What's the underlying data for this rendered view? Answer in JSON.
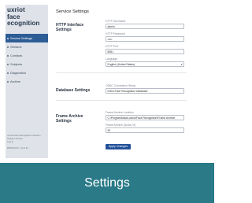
{
  "sidebar": {
    "brand": [
      "uxriot",
      "face",
      "ecognition"
    ],
    "items": [
      {
        "label": "Service Settings",
        "active": true
      },
      {
        "label": "Streams",
        "active": false
      },
      {
        "label": "Contacts",
        "active": false
      },
      {
        "label": "Subjects",
        "active": false
      },
      {
        "label": "Diagnostics",
        "active": false
      },
      {
        "label": "Archive",
        "active": false
      }
    ],
    "footer": {
      "line1": "uxriot Face Recognition Version",
      "line2": "Usage License",
      "line3": "Log In",
      "version": "PRODUCT: 1.0.0.37"
    }
  },
  "main": {
    "title": "Service Settings",
    "http": {
      "section": "HTTP Interface Settings",
      "username_label": "HTTP Username",
      "username_value": "admin",
      "password_label": "HTTP Password",
      "password_value": "•••••",
      "port_label": "HTTP Port",
      "port_value": "8081",
      "language_label": "Language",
      "language_value": "English (United States)"
    },
    "database": {
      "section": "Database Settings",
      "conn_label": "ODBC Connection String",
      "conn_value": "DSN=Face Recognition Database"
    },
    "archive": {
      "section": "Frame Archive Settings",
      "location_label": "Frame Archive Location",
      "location_value": "C:\\ProgramData\\Luxriot\\Face Recognition\\Frame Archive",
      "quota_label": "Frame Archive Quota (%)",
      "quota_value": "50"
    },
    "apply_label": "Apply Changes"
  },
  "caption": "Settings",
  "colors": {
    "sidebar_bg": "#dfe3e9",
    "active_nav": "#2d5d95",
    "apply_button": "#24529a",
    "caption_bar": "#2a7a88"
  }
}
